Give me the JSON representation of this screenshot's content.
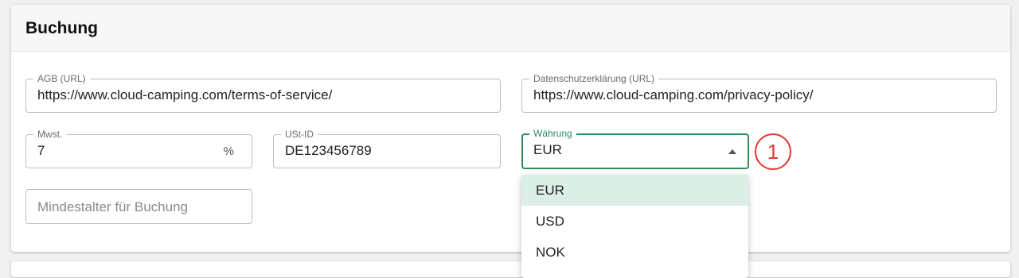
{
  "section": {
    "title": "Buchung"
  },
  "fields": {
    "agb": {
      "label": "AGB (URL)",
      "value": "https://www.cloud-camping.com/terms-of-service/"
    },
    "privacy": {
      "label": "Datenschutzerklärung (URL)",
      "value": "https://www.cloud-camping.com/privacy-policy/"
    },
    "vat": {
      "label": "Mwst.",
      "value": "7",
      "suffix": "%"
    },
    "vat_id": {
      "label": "USt-ID",
      "value": "DE123456789"
    },
    "currency": {
      "label": "Währung",
      "value": "EUR",
      "open": true
    },
    "min_age": {
      "placeholder": "Mindestalter für Buchung"
    }
  },
  "currency_options": [
    "EUR",
    "USD",
    "NOK"
  ],
  "annotation": {
    "marker": "1",
    "color": "#e53935"
  },
  "colors": {
    "accent": "#2e8b57",
    "selected_option_bg": "#dcefe6"
  }
}
